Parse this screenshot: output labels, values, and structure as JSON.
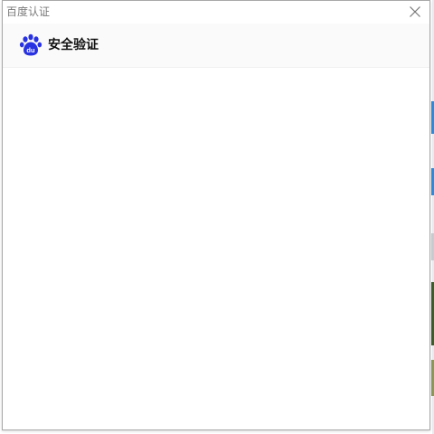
{
  "window": {
    "title": "百度认证"
  },
  "header": {
    "title": "安全验证",
    "logo_icon": "baidu-paw-icon",
    "logo_text": "du"
  },
  "colors": {
    "brand_blue": "#2932e1",
    "title_gray": "#7a7a7a"
  },
  "icons": {
    "close": "close-icon"
  }
}
